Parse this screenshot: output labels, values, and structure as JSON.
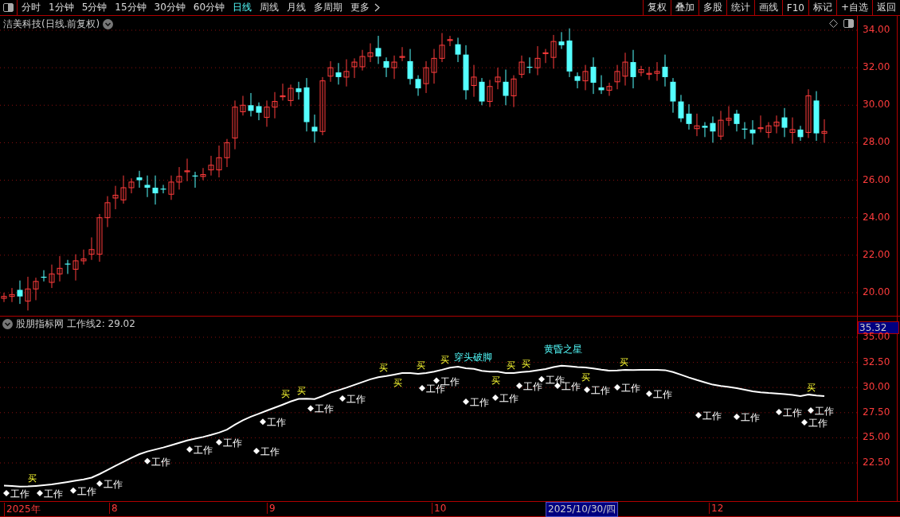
{
  "toolbar": {
    "periods": [
      {
        "label": "分时",
        "selected": false
      },
      {
        "label": "1分钟",
        "selected": false
      },
      {
        "label": "5分钟",
        "selected": false
      },
      {
        "label": "15分钟",
        "selected": false
      },
      {
        "label": "30分钟",
        "selected": false
      },
      {
        "label": "60分钟",
        "selected": false
      },
      {
        "label": "日线",
        "selected": true
      },
      {
        "label": "周线",
        "selected": false
      },
      {
        "label": "月线",
        "selected": false
      },
      {
        "label": "多周期",
        "selected": false
      }
    ],
    "more": "更多",
    "actions": [
      "复权",
      "叠加",
      "多股",
      "统计",
      "画线",
      "F10",
      "标记",
      "+自选",
      "返回"
    ]
  },
  "price_panel": {
    "title": "洁美科技(日线.前复权)",
    "axis_labels": [
      "34.00",
      "32.00",
      "30.00",
      "28.00",
      "26.00",
      "24.00",
      "22.00",
      "20.00"
    ]
  },
  "indicator_panel": {
    "name": "股朋指标网",
    "reading": "工作线2: 29.02",
    "current_value": "35.32",
    "axis_labels": [
      "35.00",
      "32.50",
      "30.00",
      "27.50",
      "25.00",
      "22.50"
    ],
    "patterns": [
      "穿头破脚",
      "黄昏之星"
    ],
    "signals": [
      {
        "kind": "work",
        "text": "工作"
      },
      {
        "kind": "work",
        "text": "工作"
      },
      {
        "kind": "work",
        "text": "工作"
      },
      {
        "kind": "work",
        "text": "工作"
      },
      {
        "kind": "work",
        "text": "工作"
      },
      {
        "kind": "work",
        "text": "工作"
      },
      {
        "kind": "work",
        "text": "工作"
      },
      {
        "kind": "work",
        "text": "工作"
      },
      {
        "kind": "work",
        "text": "工作"
      },
      {
        "kind": "work",
        "text": "工作"
      },
      {
        "kind": "work",
        "text": "工作"
      },
      {
        "kind": "work",
        "text": "工作"
      },
      {
        "kind": "work",
        "text": "工作"
      },
      {
        "kind": "work",
        "text": "工作"
      },
      {
        "kind": "work",
        "text": "工作"
      },
      {
        "kind": "work",
        "text": "工作"
      },
      {
        "kind": "work",
        "text": "工作"
      },
      {
        "kind": "work",
        "text": "工作"
      },
      {
        "kind": "work",
        "text": "工作"
      },
      {
        "kind": "work",
        "text": "工作"
      },
      {
        "kind": "work",
        "text": "工作"
      },
      {
        "kind": "work",
        "text": "工作"
      },
      {
        "kind": "work",
        "text": "工作"
      },
      {
        "kind": "work",
        "text": "工作"
      },
      {
        "kind": "work",
        "text": "工作"
      },
      {
        "kind": "work",
        "text": "工作"
      },
      {
        "kind": "buy",
        "text": "买"
      },
      {
        "kind": "buy",
        "text": "买"
      },
      {
        "kind": "buy",
        "text": "买"
      },
      {
        "kind": "buy",
        "text": "买"
      },
      {
        "kind": "buy",
        "text": "买"
      },
      {
        "kind": "buy",
        "text": "买"
      },
      {
        "kind": "buy",
        "text": "买"
      },
      {
        "kind": "buy",
        "text": "买"
      },
      {
        "kind": "buy",
        "text": "买"
      },
      {
        "kind": "buy",
        "text": "买"
      },
      {
        "kind": "buy",
        "text": "买"
      },
      {
        "kind": "buy",
        "text": "买"
      },
      {
        "kind": "buy",
        "text": "买"
      }
    ]
  },
  "time_axis": {
    "labels": [
      {
        "text": "2025年",
        "selected": false
      },
      {
        "text": "8",
        "selected": false
      },
      {
        "text": "9",
        "selected": false
      },
      {
        "text": "10",
        "selected": false
      },
      {
        "text": "2025/10/30/四",
        "selected": true
      },
      {
        "text": "12",
        "selected": false
      }
    ]
  }
}
